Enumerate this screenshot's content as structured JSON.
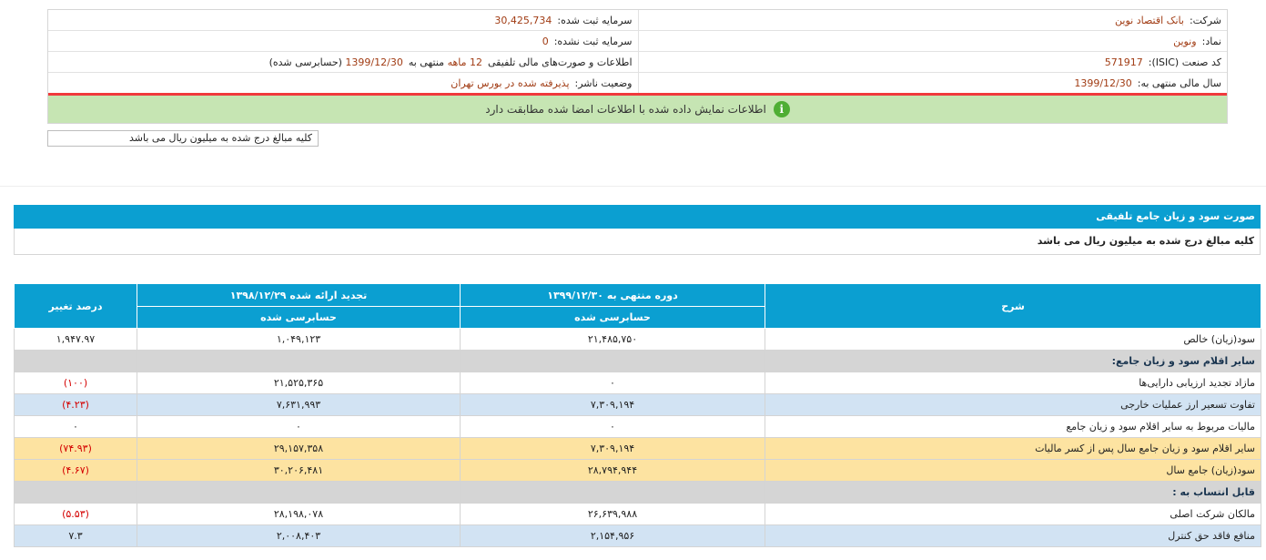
{
  "info": {
    "company_label": "شرکت:",
    "company_value": "بانک اقتصاد نوین",
    "reg_capital_label": "سرمایه ثبت شده:",
    "reg_capital_value": "30,425,734",
    "symbol_label": "نماد:",
    "symbol_value": "ونوین",
    "unreg_capital_label": "سرمایه ثبت نشده:",
    "unreg_capital_value": "0",
    "isic_label": "کد صنعت (ISIC):",
    "isic_value": "571917",
    "report_prefix": "اطلاعات و صورت‌های مالی تلفیقی",
    "report_months": "12 ماهه",
    "report_mid": "منتهی به",
    "report_date": "1399/12/30",
    "report_suffix": "(حسابرسی شده)",
    "fiscal_label": "سال مالی منتهی به:",
    "fiscal_value": "1399/12/30",
    "status_label": "وضعیت ناشر:",
    "status_value": "پذیرفته شده در بورس تهران"
  },
  "banner": {
    "icon": "info-icon",
    "text": "اطلاعات نمایش داده شده با اطلاعات امضا شده مطابقت دارد"
  },
  "unit_note": "کلیه مبالغ درج شده به میلیون ریال می باشد",
  "section": {
    "title": "صورت سود و زیان جامع تلفیقی",
    "note": "کلیه مبالغ درج شده به میلیون ریال می باشد"
  },
  "table": {
    "headers": {
      "desc": "شرح",
      "period": "دوره منتهی به ۱۳۹۹/۱۲/۳۰",
      "period_sub": "حسابرسی شده",
      "restated": "تجدید ارائه شده ۱۳۹۸/۱۲/۲۹",
      "restated_sub": "حسابرسی شده",
      "change": "درصد تغییر"
    },
    "rows": [
      {
        "desc": "سود(زیان) خالص",
        "period": "۲۱,۴۸۵,۷۵۰",
        "restated": "۱,۰۴۹,۱۲۳",
        "change": "۱,۹۴۷.۹۷"
      },
      {
        "desc": "سایر اقلام سود و زیان جامع:",
        "period": "",
        "restated": "",
        "change": ""
      },
      {
        "desc": "مازاد تجدید ارزیابی دارایی‌ها",
        "period": "۰",
        "restated": "۲۱,۵۲۵,۳۶۵",
        "change": "(۱۰۰)"
      },
      {
        "desc": "تفاوت تسعیر ارز عملیات خارجی",
        "period": "۷,۳۰۹,۱۹۴",
        "restated": "۷,۶۳۱,۹۹۳",
        "change": "(۴.۲۳)"
      },
      {
        "desc": "مالیات مربوط به سایر اقلام سود و زیان جامع",
        "period": "۰",
        "restated": "۰",
        "change": "۰"
      },
      {
        "desc": "سایر اقلام سود و زیان جامع سال پس از کسر مالیات",
        "period": "۷,۳۰۹,۱۹۴",
        "restated": "۲۹,۱۵۷,۳۵۸",
        "change": "(۷۴.۹۳)"
      },
      {
        "desc": "سود(زیان) جامع سال",
        "period": "۲۸,۷۹۴,۹۴۴",
        "restated": "۳۰,۲۰۶,۴۸۱",
        "change": "(۴.۶۷)"
      },
      {
        "desc": "قابل انتساب به :",
        "period": "",
        "restated": "",
        "change": ""
      },
      {
        "desc": "مالکان شرکت اصلی",
        "period": "۲۶,۶۳۹,۹۸۸",
        "restated": "۲۸,۱۹۸,۰۷۸",
        "change": "(۵.۵۳)"
      },
      {
        "desc": "منافع فاقد حق کنترل",
        "period": "۲,۱۵۴,۹۵۶",
        "restated": "۲,۰۰۸,۴۰۳",
        "change": "۷.۳"
      }
    ]
  }
}
